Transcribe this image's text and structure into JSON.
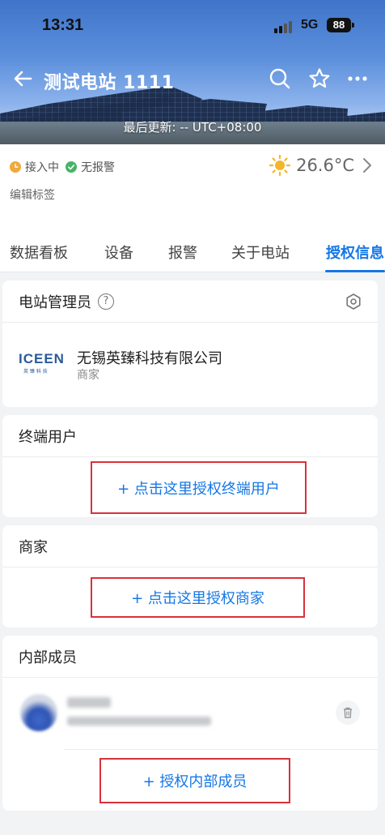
{
  "status_bar": {
    "time": "13:31",
    "network": "5G",
    "battery": "88"
  },
  "header": {
    "title": "测试电站 1111",
    "last_update": "最后更新: -- UTC+08:00",
    "icons": [
      "back-arrow-icon",
      "search-icon",
      "star-icon",
      "more-icon"
    ]
  },
  "station_status": {
    "connection": "接入中",
    "alarm": "无报警",
    "temperature": "26.6°C",
    "weather_icon": "sun-icon",
    "edit_tag": "编辑标签"
  },
  "tabs": [
    {
      "label": "数据看板"
    },
    {
      "label": "设备"
    },
    {
      "label": "报警"
    },
    {
      "label": "关于电站"
    },
    {
      "label": "授权信息",
      "active": true
    }
  ],
  "admin_card": {
    "title": "电站管理员",
    "company_name": "无锡英臻科技有限公司",
    "company_role": "商家",
    "logo_text": "ICEEN",
    "logo_subtext": "英 臻 科 技"
  },
  "end_user_card": {
    "title": "终端用户",
    "button": "+ 点击这里授权终端用户"
  },
  "merchant_card": {
    "title": "商家",
    "button": "+ 点击这里授权商家"
  },
  "internal_card": {
    "title": "内部成员",
    "button": "+ 授权内部成员"
  },
  "colors": {
    "accent": "#1677e5",
    "highlight_border": "#d9323b",
    "connecting": "#f0a93b",
    "no_alarm": "#46b467"
  }
}
